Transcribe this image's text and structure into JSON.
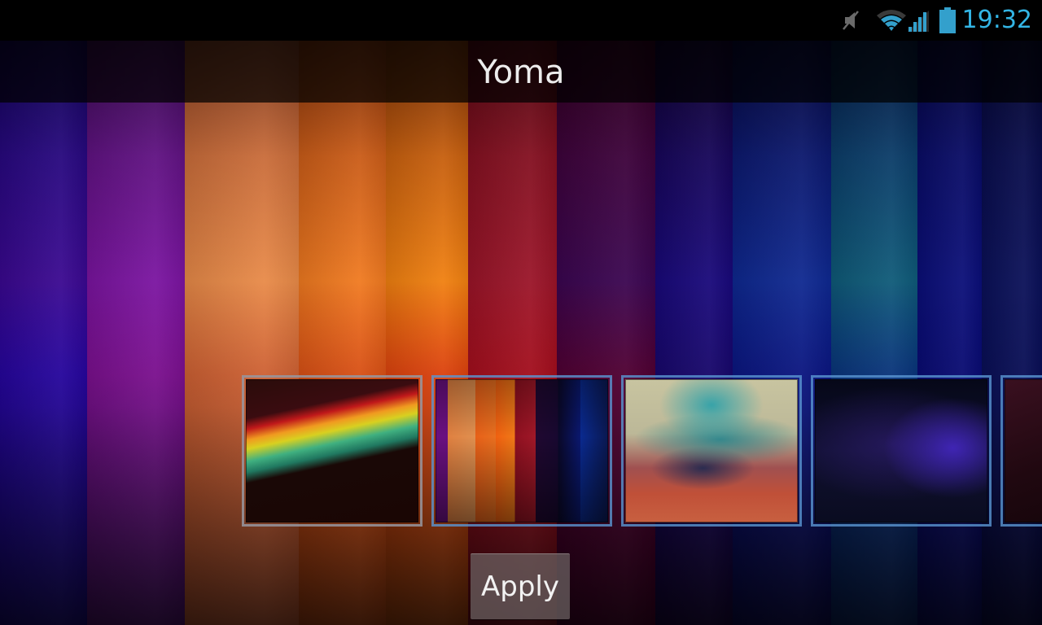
{
  "status_bar": {
    "time": "19:32",
    "icons": [
      "mute-icon",
      "wifi-icon",
      "cell-signal-icon",
      "battery-icon"
    ],
    "accent_color": "#33b5e5"
  },
  "header": {
    "title": "Yoma"
  },
  "wallpaper": {
    "name": "Yoma",
    "stripes": [
      {
        "top": "#1a0a8a",
        "bottom": "#2a06b0",
        "color": "#3a0890"
      },
      {
        "top": "#5a1580",
        "bottom": "#8a12a0",
        "color": "#7a14a0"
      },
      {
        "top": "#d86438",
        "bottom": "#e86d3a",
        "color": "#e88a48"
      },
      {
        "top": "#d05015",
        "bottom": "#f45a18",
        "color": "#f07a20"
      },
      {
        "top": "#c85010",
        "bottom": "#f84a10",
        "color": "#f08010"
      },
      {
        "top": "#8a1020",
        "bottom": "#b81020",
        "color": "#9a1428"
      },
      {
        "top": "#500030",
        "bottom": "#5a0038",
        "color": "#3a0550"
      },
      {
        "top": "#1a0548",
        "bottom": "#1a0878",
        "color": "#18087a"
      },
      {
        "top": "#0c0c60",
        "bottom": "#0c1890",
        "color": "#0e2890"
      },
      {
        "top": "#0a2870",
        "bottom": "#0a3a8a",
        "color": "#0e5a78"
      },
      {
        "top": "#0a0c68",
        "bottom": "#0a0c80",
        "color": "#0a0e78"
      },
      {
        "top": "#0a0c50",
        "bottom": "#0a1060",
        "color": "#0a1058"
      }
    ]
  },
  "thumbnails": [
    {
      "label": "Rainbow swirl wallpaper",
      "selected": true
    },
    {
      "label": "Yoma stripes wallpaper",
      "selected": false
    },
    {
      "label": "Blurred pastel wallpaper",
      "selected": false
    },
    {
      "label": "Dark purple glow wallpaper",
      "selected": false
    },
    {
      "label": "Dark red wallpaper (partially visible)",
      "selected": false
    }
  ],
  "actions": {
    "apply_label": "Apply"
  }
}
